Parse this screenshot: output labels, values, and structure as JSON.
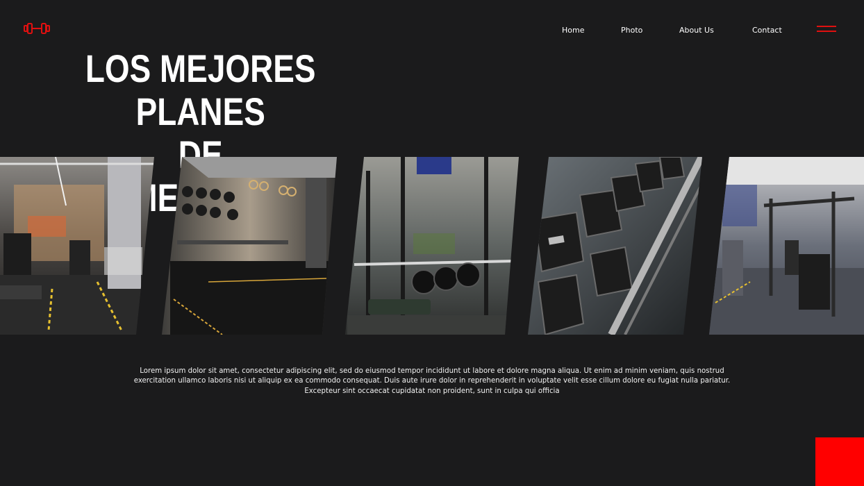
{
  "brand": {
    "logo_icon": "dumbbell-icon",
    "accent_color": "#e01010"
  },
  "nav": {
    "items": [
      {
        "label": "Home"
      },
      {
        "label": "Photo"
      },
      {
        "label": "About Us"
      },
      {
        "label": "Contact"
      }
    ],
    "menu_icon": "hamburger-icon"
  },
  "hero": {
    "title_line1": "LOS MEJORES PLANES",
    "title_line2": "DE ALIMENTACION"
  },
  "gallery": {
    "photos": [
      {
        "subject": "gym-interior-photo"
      },
      {
        "subject": "gym-rings-and-medicine-balls-photo"
      },
      {
        "subject": "power-rack-and-bench-photo"
      },
      {
        "subject": "dumbbell-rack-photo"
      },
      {
        "subject": "gym-machines-photo"
      }
    ]
  },
  "body": {
    "paragraph": "Lorem ipsum dolor sit amet, consectetur adipiscing elit, sed do eiusmod tempor incididunt ut labore et dolore magna aliqua. Ut enim ad minim veniam, quis nostrud exercitation ullamco laboris nisi ut aliquip ex ea commodo consequat. Duis aute irure dolor in reprehenderit in voluptate velit esse cillum dolore eu fugiat nulla pariatur. Excepteur sint occaecat cupidatat non proident, sunt in culpa qui officia"
  },
  "decor": {
    "corner_block_color": "#ff0000"
  }
}
